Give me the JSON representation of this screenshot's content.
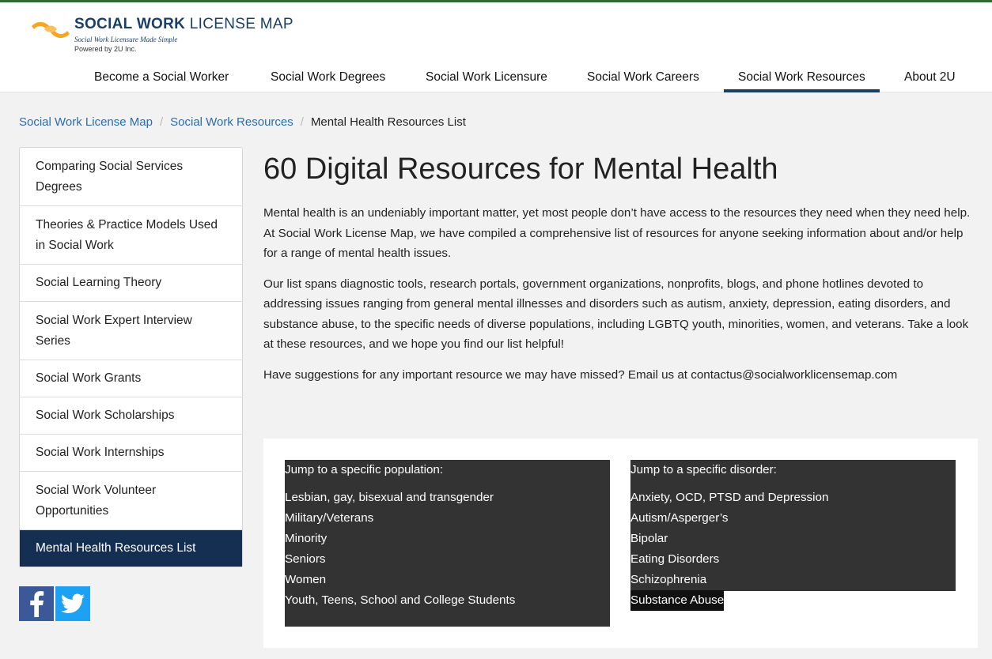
{
  "brand": {
    "name_bold": "SOCIAL WORK",
    "name_light": "LICENSE MAP",
    "tagline": "Social Work Licensure Made Simple",
    "powered_by": "Powered by 2U Inc.",
    "colors": {
      "navy": "#1a3f66",
      "gold": "#f5a623",
      "green_bar": "#2e6b2e"
    }
  },
  "nav": {
    "items": [
      {
        "label": "Become a Social Worker"
      },
      {
        "label": "Social Work Degrees"
      },
      {
        "label": "Social Work Licensure"
      },
      {
        "label": "Social Work Careers"
      },
      {
        "label": "Social Work Resources",
        "active": true
      },
      {
        "label": "About 2U"
      }
    ]
  },
  "breadcrumb": {
    "items": [
      "Social Work License Map",
      "Social Work Resources"
    ],
    "separator": "/",
    "current": "Mental Health Resources List"
  },
  "sidebar": {
    "items": [
      {
        "label": "Comparing Social Services Degrees"
      },
      {
        "label": "Theories & Practice Models Used in Social Work"
      },
      {
        "label": "Social Learning Theory"
      },
      {
        "label": "Social Work Expert Interview Series"
      },
      {
        "label": "Social Work Grants"
      },
      {
        "label": "Social Work Scholarships"
      },
      {
        "label": "Social Work Internships"
      },
      {
        "label": "Social Work Volunteer Opportunities"
      },
      {
        "label": "Mental Health Resources List",
        "active": true
      }
    ],
    "social": [
      "facebook-icon",
      "twitter-icon"
    ]
  },
  "content": {
    "title": "60 Digital Resources for Mental Health",
    "paragraphs": [
      "Mental health is an undeniably important matter, yet most people don’t have access to the resources they need when they need help. At Social Work License Map, we have compiled a comprehensive list of resources for anyone seeking information about and/or help for a range of mental health issues.",
      "Our list spans diagnostic tools, research portals, government organizations, nonprofits, blogs, and phone hotlines devoted to addressing issues ranging from general mental illnesses and disorders such as autism, anxiety, depression, eating disorders, and substance abuse, to the specific needs of diverse populations, including LGBTQ youth, minorities, women, and veterans. Take a look at these resources, and we hope you find our list helpful!",
      "Have suggestions for any important resource we may have missed? Email us at contactus@socialworklicensemap.com"
    ]
  },
  "jump_population": {
    "heading": "Jump to a specific population:",
    "links": [
      "Lesbian, gay, bisexual and transgender",
      "Military/Veterans",
      "Minority",
      "Seniors",
      "Women",
      "Youth, Teens, School and College Students"
    ]
  },
  "jump_disorder": {
    "heading": "Jump to a specific disorder:",
    "links": [
      "Anxiety, OCD, PTSD and Depression",
      "Autism/Asperger’s",
      "Bipolar",
      "Eating Disorders",
      "Schizophrenia",
      "Substance Abuse"
    ]
  }
}
